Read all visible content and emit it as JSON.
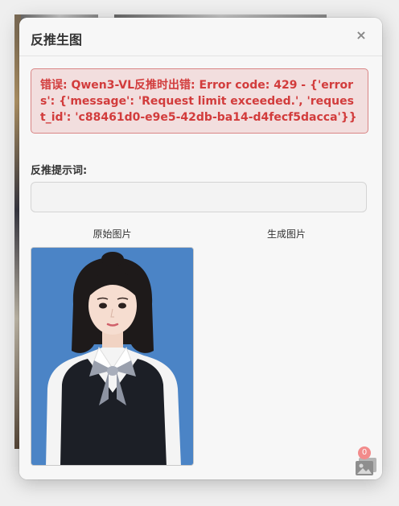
{
  "modal": {
    "title": "反推生图",
    "close_label": "×"
  },
  "error": {
    "message": "错误: Qwen3-VL反推时出错: Error code: 429 - {'errors': {'message': 'Request limit exceeded.', 'request_id': 'c88461d0-e9e5-42db-ba14-d4fecf5dacca'}}"
  },
  "prompt": {
    "label": "反推提示词:",
    "value": ""
  },
  "columns": {
    "original_label": "原始图片",
    "generated_label": "生成图片"
  },
  "gallery": {
    "badge_count": "0"
  },
  "colors": {
    "error_text": "#d23c3c",
    "error_bg": "#f2dede",
    "portrait_bg": "#4b84c6"
  }
}
